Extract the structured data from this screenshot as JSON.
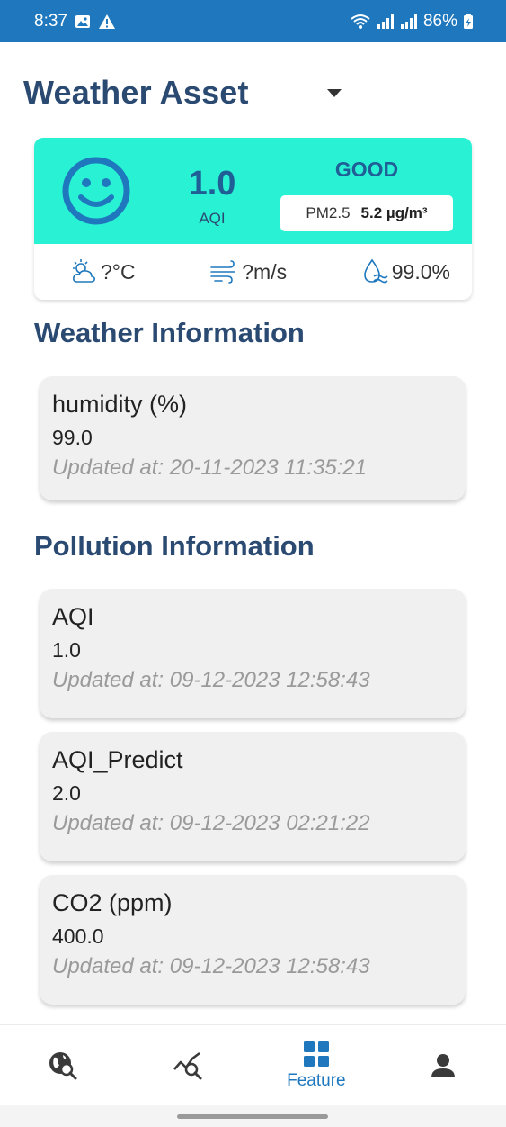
{
  "status_bar": {
    "time": "8:37",
    "battery": "86%"
  },
  "header": {
    "title": "Weather Asset"
  },
  "aqi_card": {
    "aqi_value": "1.0",
    "aqi_label": "AQI",
    "status": "GOOD",
    "pm_label": "PM2.5",
    "pm_value": "5.2 µg/m³",
    "temperature": "?°C",
    "wind": "?m/s",
    "humidity": "99.0%",
    "accent_color": "#29f2d4"
  },
  "weather_section": {
    "title": "Weather Information",
    "items": [
      {
        "name": "humidity (%)",
        "value": "99.0",
        "updated": "Updated at: 20-11-2023 11:35:21"
      }
    ]
  },
  "pollution_section": {
    "title": "Pollution Information",
    "items": [
      {
        "name": "AQI",
        "value": "1.0",
        "updated": "Updated at: 09-12-2023 12:58:43"
      },
      {
        "name": "AQI_Predict",
        "value": "2.0",
        "updated": "Updated at: 09-12-2023 02:21:22"
      },
      {
        "name": "CO2 (ppm)",
        "value": "400.0",
        "updated": "Updated at: 09-12-2023 12:58:43"
      }
    ]
  },
  "bottom_nav": {
    "items": [
      {
        "icon": "globe-search-icon",
        "label": ""
      },
      {
        "icon": "chart-search-icon",
        "label": ""
      },
      {
        "icon": "grid-icon",
        "label": "Feature"
      },
      {
        "icon": "person-icon",
        "label": ""
      }
    ],
    "active_color": "#1f78bd"
  }
}
